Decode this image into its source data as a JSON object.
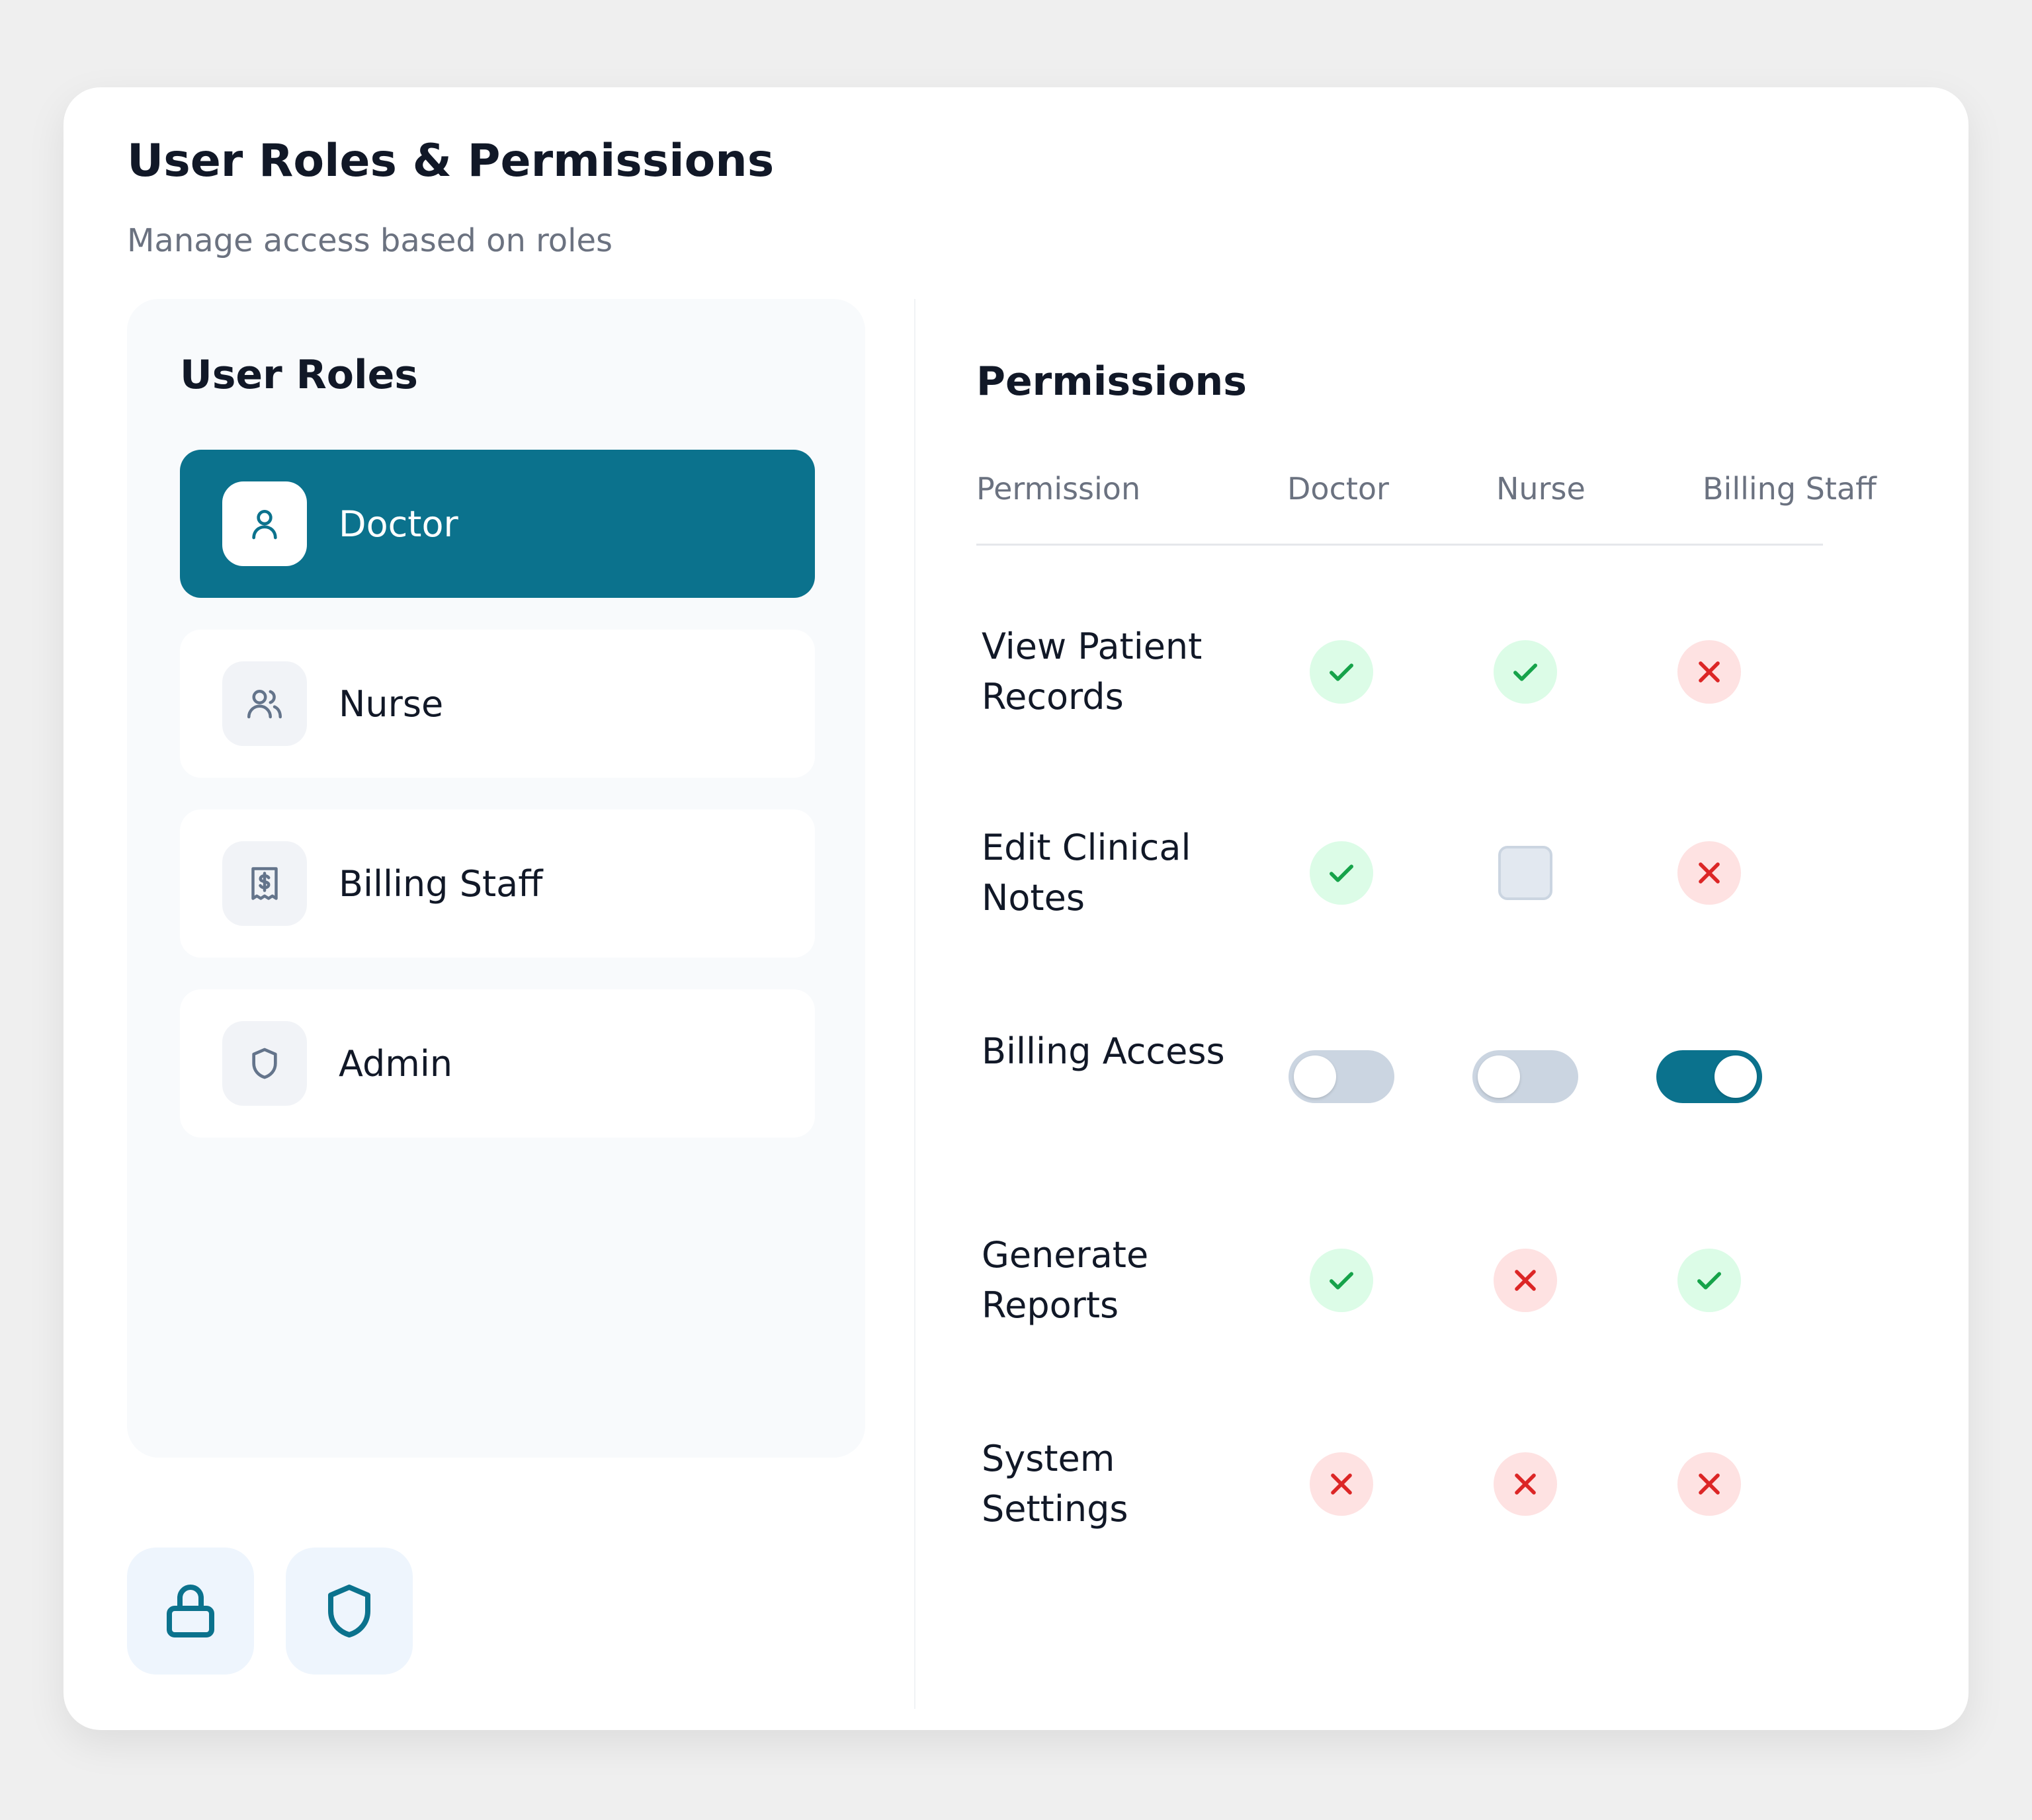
{
  "header": {
    "title": "User Roles & Permissions",
    "subtitle": "Manage access based on roles"
  },
  "roles": {
    "heading": "User Roles",
    "selected": "Doctor",
    "items": [
      {
        "label": "Doctor",
        "icon": "user-icon"
      },
      {
        "label": "Nurse",
        "icon": "users-icon"
      },
      {
        "label": "Billing Staff",
        "icon": "receipt-icon"
      },
      {
        "label": "Admin",
        "icon": "shield-icon"
      }
    ]
  },
  "quick_actions": [
    {
      "icon": "lock-icon"
    },
    {
      "icon": "shield-icon"
    }
  ],
  "permissions": {
    "heading": "Permissions",
    "columns": [
      "Permission",
      "Doctor",
      "Nurse",
      "Billing Staff"
    ],
    "rows": [
      {
        "name": "View Patient Records",
        "cells": [
          "granted",
          "granted",
          "denied"
        ]
      },
      {
        "name": "Edit Clinical Notes",
        "cells": [
          "granted",
          "unchecked",
          "denied"
        ]
      },
      {
        "name": "Billing Access",
        "cells": [
          "toggle-off",
          "toggle-off",
          "toggle-on"
        ]
      },
      {
        "name": "Generate Reports",
        "cells": [
          "granted",
          "denied",
          "granted"
        ]
      },
      {
        "name": "System Settings",
        "cells": [
          "denied",
          "denied",
          "denied"
        ]
      }
    ]
  },
  "colors": {
    "accent": "#0b728d",
    "granted": "#16a34a",
    "granted_bg": "#dcfce7",
    "denied": "#dc2626",
    "denied_bg": "#fee2e2"
  }
}
